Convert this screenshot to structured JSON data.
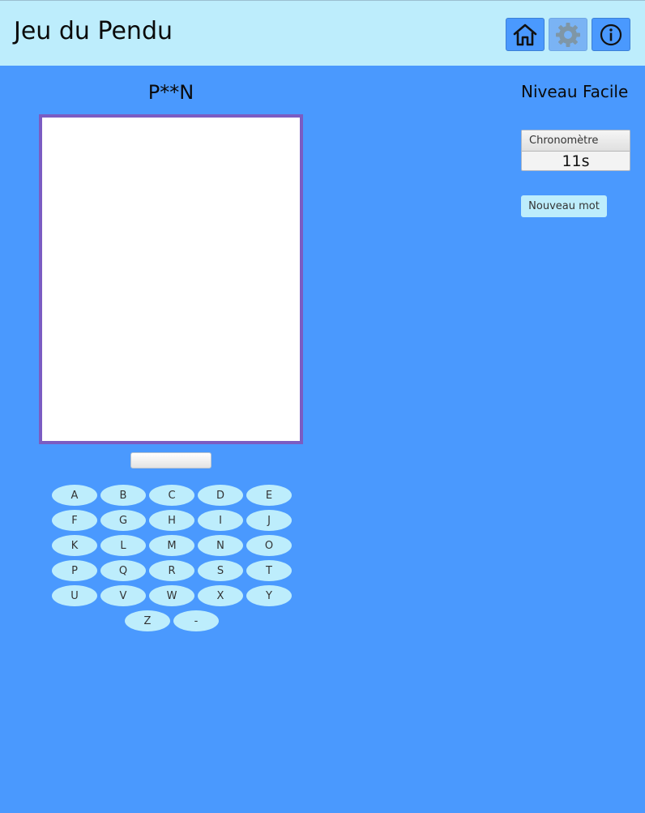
{
  "header": {
    "title": "Jeu du Pendu",
    "icons": [
      "home-icon",
      "gear-icon",
      "info-icon"
    ]
  },
  "game": {
    "masked_word": "P**N",
    "letter_input_value": "",
    "level": "Niveau Facile",
    "timer_label": "Chronomètre",
    "timer_value": "11s",
    "new_word_label": "Nouveau mot"
  },
  "keyboard": {
    "rows": [
      [
        "A",
        "B",
        "C",
        "D",
        "E"
      ],
      [
        "F",
        "G",
        "H",
        "I",
        "J"
      ],
      [
        "K",
        "L",
        "M",
        "N",
        "O"
      ],
      [
        "P",
        "Q",
        "R",
        "S",
        "T"
      ],
      [
        "U",
        "V",
        "W",
        "X",
        "Y"
      ],
      [
        "Z",
        "-"
      ]
    ]
  },
  "colors": {
    "background": "#4a99fe",
    "header": "#bdedfc",
    "frame": "#7b5cc2",
    "key": "#bdedfc"
  }
}
